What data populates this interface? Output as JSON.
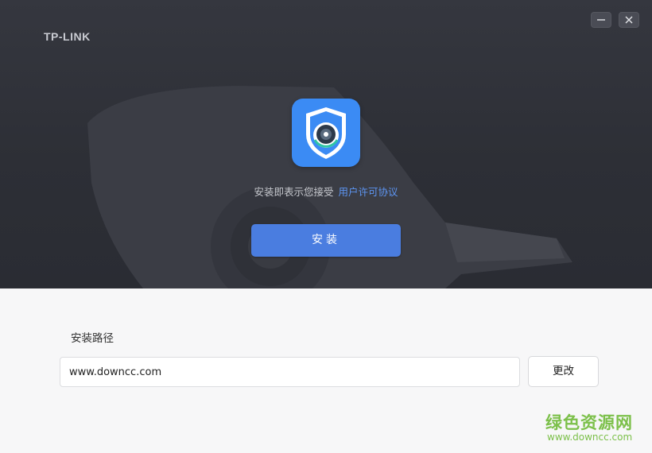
{
  "window": {
    "brand": "TP-LINK",
    "minimize_icon": "minimize-icon",
    "close_icon": "close-icon"
  },
  "hero": {
    "app_icon": "shield-camera-icon",
    "consent_text": "安装即表示您接受",
    "agreement_link": "用户许可协议",
    "install_button": "安装"
  },
  "install_path": {
    "label": "安装路径",
    "value": "www.downcc.com",
    "change_button": "更改"
  },
  "watermark": {
    "title": "绿色资源网",
    "url": "www.downcc.com"
  },
  "colors": {
    "hero_bg": "#2e3037",
    "accent": "#4a7de0",
    "link": "#5d95f2",
    "icon_bg": "#3b8bf4",
    "watermark": "#7cc04a"
  }
}
